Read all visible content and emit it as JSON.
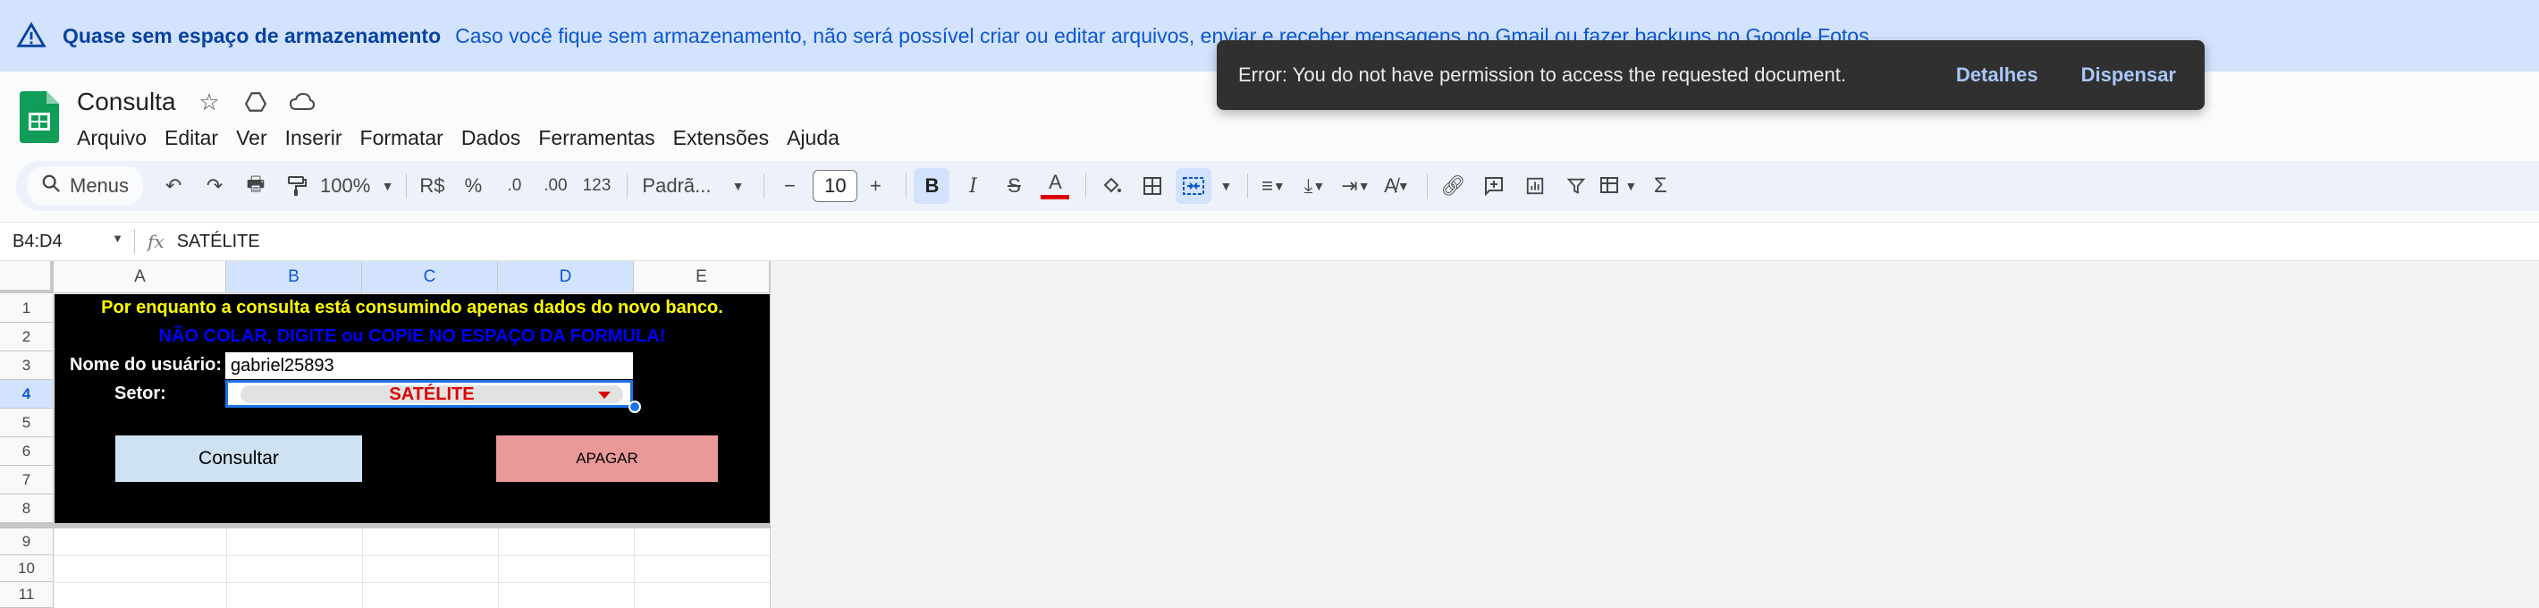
{
  "banner": {
    "title": "Quase sem espaço de armazenamento",
    "message": "Caso você fique sem armazenamento, não será possível criar ou editar arquivos, enviar e receber mensagens no Gmail ou fazer backups no Google Fotos."
  },
  "doc": {
    "title": "Consulta"
  },
  "menu": [
    "Arquivo",
    "Editar",
    "Ver",
    "Inserir",
    "Formatar",
    "Dados",
    "Ferramentas",
    "Extensões",
    "Ajuda"
  ],
  "toolbar": {
    "search_label": "Menus",
    "zoom": "100%",
    "currency": "R$",
    "percent": "%",
    "dec_decrease": ".0",
    "dec_increase": ".00",
    "number_format": "123",
    "font": "Padrã...",
    "font_size": "10"
  },
  "formula_bar": {
    "name_box": "B4:D4",
    "fx": "fx",
    "content": "SATÉLITE"
  },
  "grid": {
    "columns": [
      "A",
      "B",
      "C",
      "D",
      "E"
    ],
    "rows": [
      "1",
      "2",
      "3",
      "4",
      "5",
      "6",
      "7",
      "8",
      "9",
      "10",
      "11"
    ]
  },
  "sheet": {
    "line1": "Por enquanto a consulta está consumindo apenas dados do novo banco.",
    "line2": "NÃO COLAR, DIGITE ou COPIE NO ESPAÇO DA FORMULA!",
    "user_label": "Nome do usuário:",
    "user_value": "gabriel25893",
    "sector_label": "Setor:",
    "sector_value": "SATÉLITE",
    "btn_consultar": "Consultar",
    "btn_apagar": "APAGAR"
  },
  "toast": {
    "message": "Error: You do not have permission to access the requested document.",
    "details": "Detalhes",
    "dismiss": "Dispensar"
  },
  "colors": {
    "banner_bg": "#d3e3fd",
    "line1": "#ffff00",
    "line2": "#0000ff",
    "sector_text": "#dd0000",
    "btn_consultar": "#cfe2f3",
    "btn_apagar": "#ea9999"
  }
}
